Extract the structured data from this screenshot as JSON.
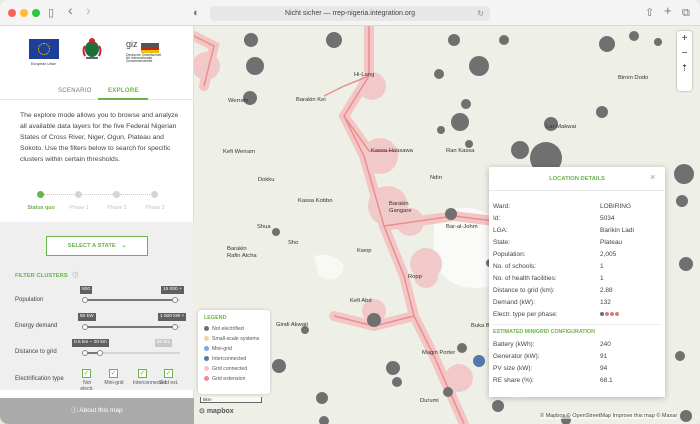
{
  "browser": {
    "url": "Nicht sicher — rrep-nigeria.integration.org",
    "back_glyph": "‹",
    "forward_glyph": "›",
    "reload_glyph": "↻",
    "share_glyph": "⇧",
    "newtab_glyph": "+",
    "tabs_glyph": "⧉",
    "sidebar_glyph": "▯",
    "shield_glyph": "◐"
  },
  "logos": {
    "eu_caption": "European Union",
    "giz_text": "giz",
    "giz_caption": "Deutsche Gesellschaft für Internationale Zusammenarbeit"
  },
  "tabs": {
    "scenario": "SCENARIO",
    "explore": "EXPLORE"
  },
  "intro": "The explore mode allows you to browse and analyze all available data layers for the five Federal Nigerian States of Cross River, Niger, Ogun, Plateau and Sokoto. Use the filters below to search for specific clusters within certain thresholds.",
  "steps": [
    "Status quo",
    "Phase 1",
    "Phase 2",
    "Phase 3"
  ],
  "filters": {
    "select_state": "SELECT A STATE",
    "title": "FILTER CLUSTERS",
    "info_glyph": "ⓘ",
    "population": {
      "label": "Population",
      "min": "500",
      "max": "15 000 +"
    },
    "energy": {
      "label": "Energy demand",
      "min": "50 kW",
      "max": "1 500 kW +"
    },
    "distance": {
      "label": "Distance to grid",
      "value": "0.5 km – 20 km",
      "max": "50 km"
    },
    "electrification": {
      "label": "Electrification type",
      "options": [
        "Not electr.",
        "Mini-grid",
        "Interconnected",
        "Grid ext."
      ]
    }
  },
  "about": "About this map",
  "map": {
    "towns": [
      "Hi-Lang",
      "Barakin Kei",
      "Werram",
      "Kefi Werram",
      "Dokku",
      "Kassa Kobbo",
      "Kassa Hausawa",
      "Ran Kassa",
      "Barakin Gangare",
      "Ndin",
      "Shua",
      "Sho",
      "Barakin Rafin Atcha",
      "Kwop",
      "Bar-al-Johm",
      "Birnin Dodo",
      "Lar-Makwai",
      "Ropp",
      "Kefi Abd",
      "Gindi Akwati",
      "Buka Bo",
      "Magin Porter",
      "Durumi"
    ],
    "zoom_in": "+",
    "zoom_out": "−",
    "compass": "⇡",
    "legend": {
      "title": "LEGEND",
      "items": [
        {
          "label": "Not electrified",
          "color": "#6f6f6f"
        },
        {
          "label": "Small-scale systems",
          "color": "#e9d7a2"
        },
        {
          "label": "Mini-grid",
          "color": "#7ba7d9"
        },
        {
          "label": "Interconnected",
          "color": "#5577a9"
        },
        {
          "label": "Grid connected",
          "color": "#f2c9c9"
        },
        {
          "label": "Grid extension",
          "color": "#e88f8f"
        }
      ]
    },
    "scale": "5km",
    "mapbox_logo": "mapbox",
    "attribution": "© Mapbox © OpenStreetMap Improve this map © Maxar"
  },
  "popup": {
    "title": "LOCATION DETAILS",
    "close": "×",
    "details": [
      {
        "k": "Ward:",
        "v": "LOBIRING"
      },
      {
        "k": "Id:",
        "v": "5034"
      },
      {
        "k": "LGA:",
        "v": "Barikin Ladi"
      },
      {
        "k": "State:",
        "v": "Plateau"
      },
      {
        "k": "Population:",
        "v": "2,005"
      },
      {
        "k": "No. of schools:",
        "v": "1"
      },
      {
        "k": "No. of health facilities:",
        "v": "1"
      },
      {
        "k": "Distance to grid (km):",
        "v": "2.88"
      },
      {
        "k": "Demand (kW):",
        "v": "132"
      },
      {
        "k": "Electr. type per phase:",
        "v": ""
      }
    ],
    "phase_colors": [
      "#6f6f6f",
      "#d97c7c",
      "#d97c7c",
      "#d97c7c"
    ],
    "minigrid_title": "ESTIMATED MINIGRID CONFIGURATION",
    "minigrid": [
      {
        "k": "Battery (kWh):",
        "v": "240"
      },
      {
        "k": "Generator (kW):",
        "v": "91"
      },
      {
        "k": "PV size (kW):",
        "v": "94"
      },
      {
        "k": "RE share (%):",
        "v": "68.1"
      }
    ]
  },
  "colors": {
    "accent": "#6bb34a",
    "cluster": "#6f6f6f",
    "grid": "#e88f8f"
  }
}
